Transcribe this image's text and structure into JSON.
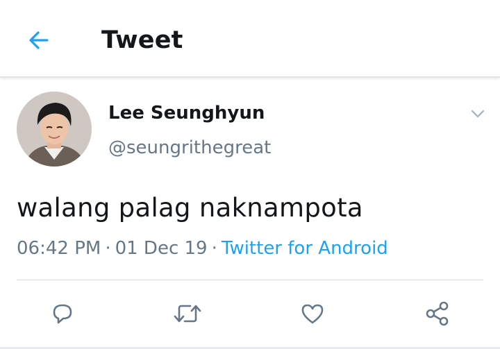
{
  "header": {
    "title": "Tweet",
    "back_icon": "arrow-left-icon"
  },
  "tweet": {
    "author": {
      "display_name": "Lee Seunghyun",
      "handle": "@seungrithegreat"
    },
    "text": "walang palag naknampota",
    "time": "06:42 PM",
    "date": "01 Dec 19",
    "separator": "·",
    "source": "Twitter for Android"
  },
  "actions": [
    {
      "name": "reply-icon"
    },
    {
      "name": "retweet-icon"
    },
    {
      "name": "like-icon"
    },
    {
      "name": "share-icon"
    }
  ],
  "colors": {
    "accent": "#1da1f2",
    "text_primary": "#14171a",
    "text_secondary": "#657786",
    "icon_gray": "#657786"
  }
}
